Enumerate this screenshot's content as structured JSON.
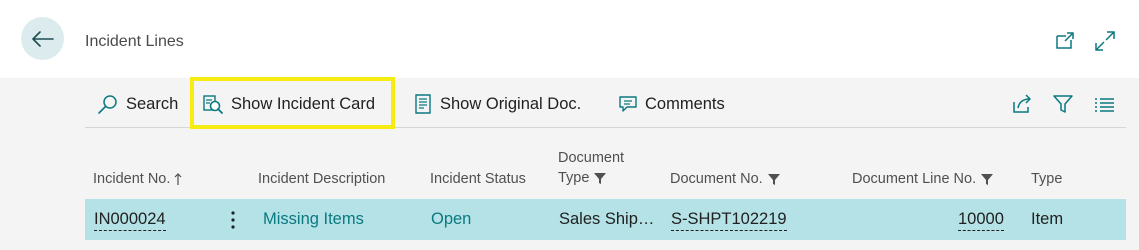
{
  "header": {
    "title": "Incident Lines",
    "back_icon": "back-arrow-icon",
    "open_new_window_icon": "open-new-window-icon",
    "expand_icon": "expand-icon"
  },
  "toolbar": {
    "search_label": "Search",
    "show_incident_card_label": "Show Incident Card",
    "show_original_doc_label": "Show Original Doc.",
    "comments_label": "Comments",
    "highlight_color": "#f7ec12"
  },
  "table": {
    "columns": [
      {
        "label": "Incident No.",
        "sort": "ascending"
      },
      {
        "label": "Incident Description"
      },
      {
        "label": "Incident Status"
      },
      {
        "label_line1": "Document",
        "label_line2": "Type",
        "filtered": true
      },
      {
        "label": "Document No.",
        "filtered": true
      },
      {
        "label": "Document Line No.",
        "filtered": true
      },
      {
        "label": "Type"
      }
    ],
    "rows": [
      {
        "incident_no": "IN000024",
        "description": "Missing Items",
        "status": "Open",
        "document_type": "Sales Ship…",
        "document_no": "S-SHPT102219",
        "document_line_no": "10000",
        "type": "Item"
      }
    ]
  },
  "colors": {
    "selected_row": "#b4e2e6",
    "accent": "#0a7a80"
  }
}
